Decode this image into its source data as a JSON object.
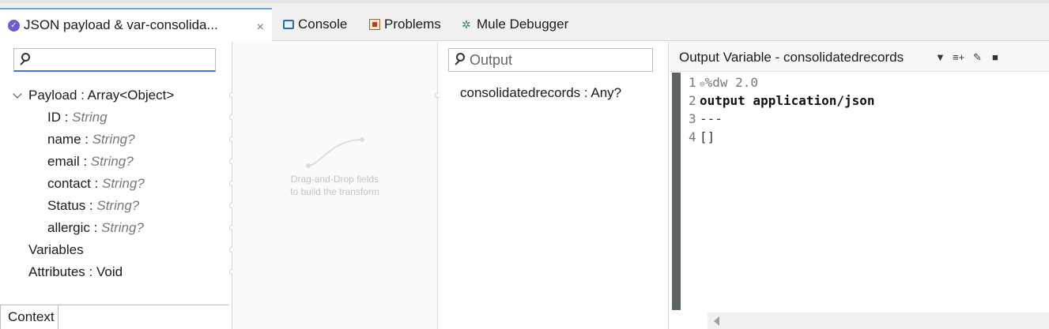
{
  "tabs": [
    {
      "label": "JSON payload &  var-consolida...",
      "icon": "dataweave-icon",
      "active": true
    },
    {
      "label": "Console",
      "icon": "console-icon"
    },
    {
      "label": "Problems",
      "icon": "problems-icon"
    },
    {
      "label": "Mule Debugger",
      "icon": "bug-icon"
    }
  ],
  "close_glyph": "×",
  "input_tree": {
    "search_placeholder": "",
    "root": {
      "name": "Payload",
      "sep": " : ",
      "type": "Array<Object>"
    },
    "fields": [
      {
        "name": "ID",
        "sep": " : ",
        "type": "String"
      },
      {
        "name": "name",
        "sep": " : ",
        "type": "String?"
      },
      {
        "name": "email",
        "sep": " : ",
        "type": "String?"
      },
      {
        "name": "contact",
        "sep": " : ",
        "type": "String?"
      },
      {
        "name": "Status",
        "sep": " : ",
        "type": "String?"
      },
      {
        "name": "allergic",
        "sep": " : ",
        "type": "String?"
      }
    ],
    "variables": "Variables",
    "attributes": "Attributes : Void",
    "context_tab": "Context"
  },
  "mapping": {
    "hint_line1": "Drag-and-Drop fields",
    "hint_line2": "to build the transform"
  },
  "output_tree": {
    "search_placeholder": "Output",
    "row": "consolidatedrecords : Any?"
  },
  "editor": {
    "title": "Output  Variable - consolidatedrecords",
    "lines": [
      {
        "num": "1",
        "fold": "⊖",
        "text": "%dw 2.0",
        "style": "comment"
      },
      {
        "num": "2",
        "fold": "",
        "text": "output application/json",
        "style": "bold"
      },
      {
        "num": "3",
        "fold": "",
        "text": "---",
        "style": "plain"
      },
      {
        "num": "4",
        "fold": "",
        "text": "[]",
        "style": "plain"
      }
    ]
  },
  "colors": {
    "accent": "#3a7bd5",
    "dataweave": "#6d5bd6",
    "gutter": "#5a6360"
  }
}
